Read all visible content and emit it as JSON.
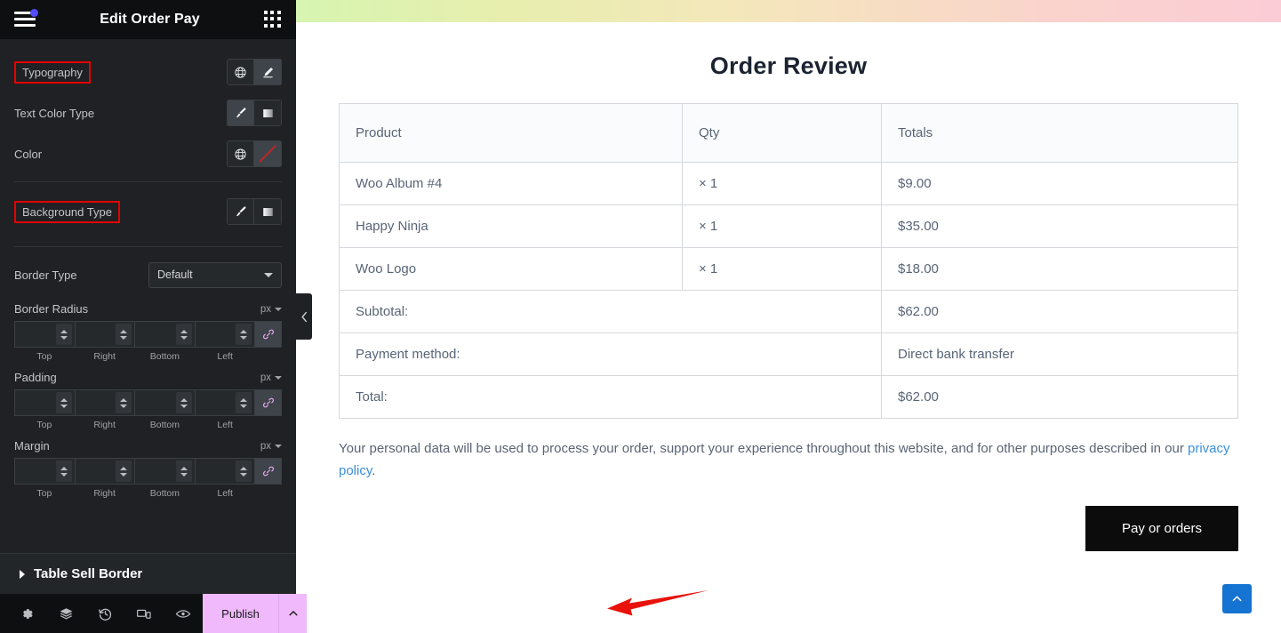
{
  "panel": {
    "title": "Edit Order Pay",
    "menu_icon": "hamburger-icon",
    "apps_icon": "grid-apps-icon",
    "controls": [
      {
        "label": "Typography",
        "highlighted": true,
        "buttons": [
          "globe-icon",
          "pencil-icon"
        ],
        "active_index": 1
      },
      {
        "label": "Text Color Type",
        "highlighted": false,
        "buttons": [
          "brush-icon",
          "gradient-icon"
        ],
        "active_index": 0
      },
      {
        "label": "Color",
        "highlighted": false,
        "buttons": [
          "globe-icon",
          "no-color-icon"
        ],
        "active_index": 1
      },
      {
        "label": "Background Type",
        "highlighted": true,
        "buttons": [
          "brush-icon",
          "gradient-icon"
        ],
        "active_index": -1
      }
    ],
    "border_type": {
      "label": "Border Type",
      "value": "Default"
    },
    "dimension_groups": [
      {
        "name": "Border Radius",
        "unit": "px",
        "values": [
          "",
          "",
          "",
          ""
        ],
        "linked": true
      },
      {
        "name": "Padding",
        "unit": "px",
        "values": [
          "",
          "",
          "",
          ""
        ],
        "linked": true
      },
      {
        "name": "Margin",
        "unit": "px",
        "values": [
          "",
          "",
          "",
          ""
        ],
        "linked": true
      }
    ],
    "dimension_labels": [
      "Top",
      "Right",
      "Bottom",
      "Left"
    ],
    "section": {
      "label": "Table Sell Border",
      "expanded": false
    },
    "footer": {
      "icons": [
        "settings-gear-icon",
        "layers-navigator-icon",
        "history-revisions-icon",
        "responsive-mode-icon",
        "preview-eye-icon"
      ],
      "publish_label": "Publish",
      "publish_color": "#efb9fb",
      "publish_arrow_icon": "chevron-up-icon"
    },
    "collapse_handle_icon": "chevron-left-icon"
  },
  "canvas": {
    "heading": "Order Review",
    "table": {
      "headers": [
        "Product",
        "Qty",
        "Totals"
      ],
      "rows": [
        {
          "product": "Woo Album #4",
          "qty": "× 1",
          "total": "$9.00"
        },
        {
          "product": "Happy Ninja",
          "qty": "× 1",
          "total": "$35.00"
        },
        {
          "product": "Woo Logo",
          "qty": "× 1",
          "total": "$18.00"
        }
      ],
      "summary": [
        {
          "label": "Subtotal:",
          "value": "$62.00"
        },
        {
          "label": "Payment method:",
          "value": "Direct bank transfer"
        },
        {
          "label": "Total:",
          "value": "$62.00"
        }
      ]
    },
    "privacy": {
      "text_before": "Your personal data will be used to process your order, support your experience throughout this website, and for other purposes described in our ",
      "link_text": "privacy policy",
      "text_after": "."
    },
    "pay_button": "Pay or orders",
    "scroll_top_icon": "chevron-up-icon",
    "scroll_top_color": "#1573d1",
    "annotation_arrow": {
      "color": "#e8120b",
      "direction": "left"
    }
  }
}
